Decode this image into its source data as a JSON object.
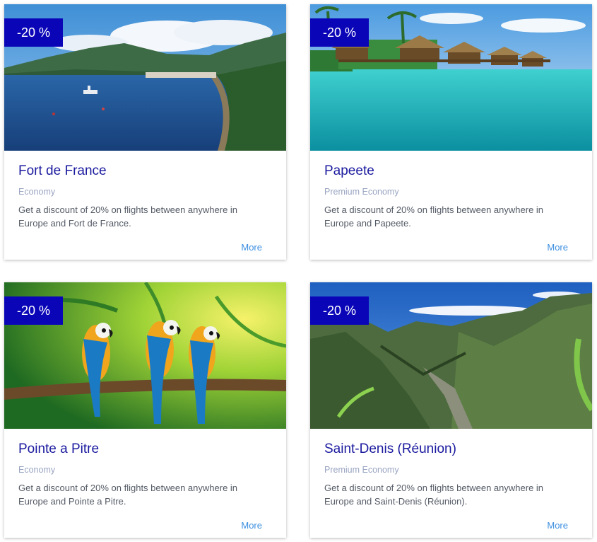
{
  "cards": [
    {
      "badge": "-20 %",
      "title": "Fort de France",
      "class": "Economy",
      "description": "Get a discount of 20% on flights between anywhere in Europe and Fort de France.",
      "more": "More",
      "image": "bay-with-green-mountains-photo"
    },
    {
      "badge": "-20 %",
      "title": "Papeete",
      "class": "Premium Economy",
      "description": "Get a discount of 20% on flights between anywhere in Europe and Papeete.",
      "more": "More",
      "image": "overwater-bungalows-turquoise-lagoon-photo"
    },
    {
      "badge": "-20 %",
      "title": "Pointe a Pitre",
      "class": "Economy",
      "description": "Get a discount of 20% on flights between anywhere in Europe and Pointe a Pitre.",
      "more": "More",
      "image": "three-macaws-on-branch-photo"
    },
    {
      "badge": "-20 %",
      "title": "Saint-Denis (Réunion)",
      "class": "Premium Economy",
      "description": "Get a discount of 20% on flights between anywhere in Europe and Saint-Denis (Réunion).",
      "more": "More",
      "image": "green-mountain-canyon-photo"
    }
  ],
  "colors": {
    "badge_bg": "#0a06b8",
    "title": "#1b1a9f",
    "class_label": "#9aa5c2",
    "more_link": "#3d8fe0"
  }
}
